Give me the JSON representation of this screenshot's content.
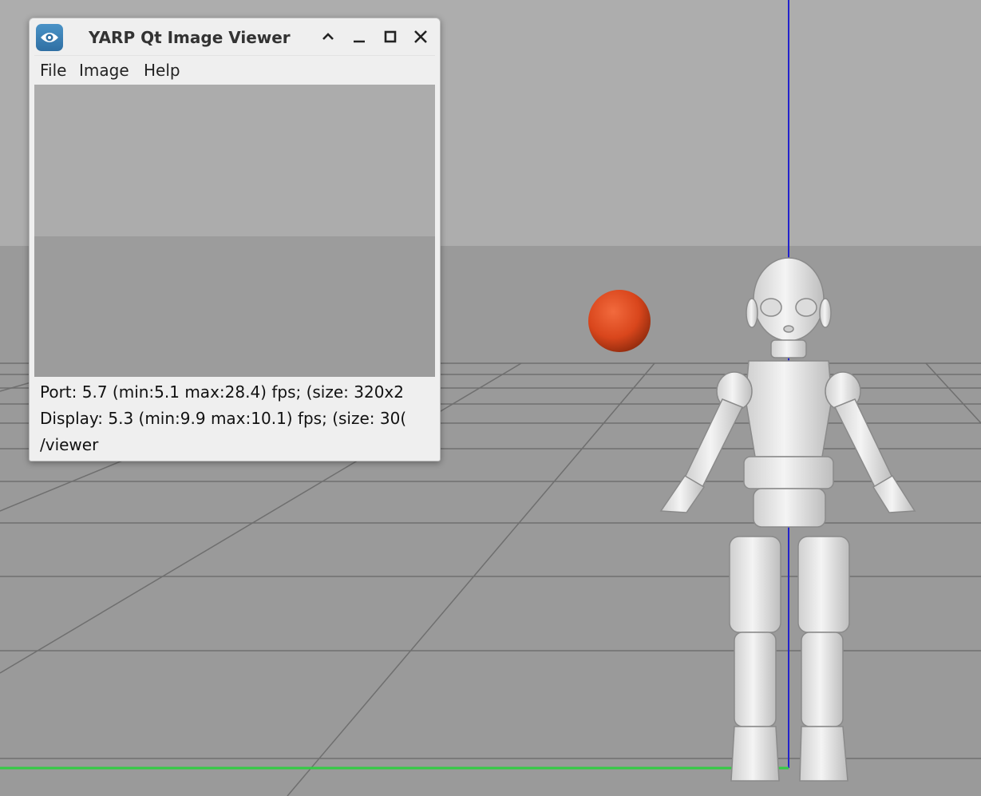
{
  "window": {
    "title": "YARP Qt Image Viewer",
    "icon": "eye-icon",
    "controls": [
      "shade-icon",
      "minimize-icon",
      "maximize-icon",
      "close-icon"
    ]
  },
  "menubar": {
    "items": [
      "File",
      "Image",
      "Help"
    ]
  },
  "status": {
    "port": "Port: 5.7 (min:5.1 max:28.4) fps; (size: 320x2",
    "display": "Display: 5.3 (min:9.9 max:10.1) fps; (size: 30(",
    "port_name": "/viewer"
  },
  "scene": {
    "background_color": "#9a9a9a",
    "sky_color": "#adadad",
    "ball_color": "#d9461c",
    "z_axis_color": "#2222cc",
    "x_axis_color": "#33cc44"
  }
}
